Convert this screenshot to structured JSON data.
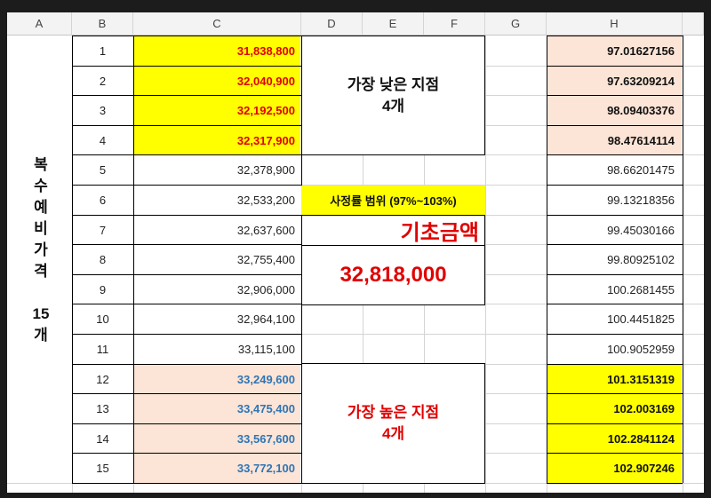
{
  "columns": [
    "A",
    "B",
    "C",
    "D",
    "E",
    "F",
    "G",
    "H"
  ],
  "vertical_label": [
    "복",
    "수",
    "예",
    "비",
    "가",
    "격",
    "",
    "15",
    "개"
  ],
  "rows": [
    {
      "b": "1",
      "c": "31,838,800",
      "h": "97.01627156"
    },
    {
      "b": "2",
      "c": "32,040,900",
      "h": "97.63209214"
    },
    {
      "b": "3",
      "c": "32,192,500",
      "h": "98.09403376"
    },
    {
      "b": "4",
      "c": "32,317,900",
      "h": "98.47614114"
    },
    {
      "b": "5",
      "c": "32,378,900",
      "h": "98.66201475"
    },
    {
      "b": "6",
      "c": "32,533,200",
      "h": "99.13218356"
    },
    {
      "b": "7",
      "c": "32,637,600",
      "h": "99.45030166"
    },
    {
      "b": "8",
      "c": "32,755,400",
      "h": "99.80925102"
    },
    {
      "b": "9",
      "c": "32,906,000",
      "h": "100.2681455"
    },
    {
      "b": "10",
      "c": "32,964,100",
      "h": "100.4451825"
    },
    {
      "b": "11",
      "c": "33,115,100",
      "h": "100.9052959"
    },
    {
      "b": "12",
      "c": "33,249,600",
      "h": "101.3151319"
    },
    {
      "b": "13",
      "c": "33,475,400",
      "h": "102.003169"
    },
    {
      "b": "14",
      "c": "33,567,600",
      "h": "102.2841124"
    },
    {
      "b": "15",
      "c": "33,772,100",
      "h": "102.907246"
    }
  ],
  "lowest_box": {
    "line1": "가장 낮은 지점",
    "line2": "4개"
  },
  "highest_box": {
    "line1": "가장 높은 지점",
    "line2": "4개"
  },
  "range_label": "사정률 범위 (97%~103%)",
  "base_amount_label": "기초금액",
  "base_amount_value": "32,818,000",
  "colors": {
    "yellow": "#ffff00",
    "peach": "#fce4d6",
    "red": "#e00000",
    "blue": "#2e75b6"
  }
}
